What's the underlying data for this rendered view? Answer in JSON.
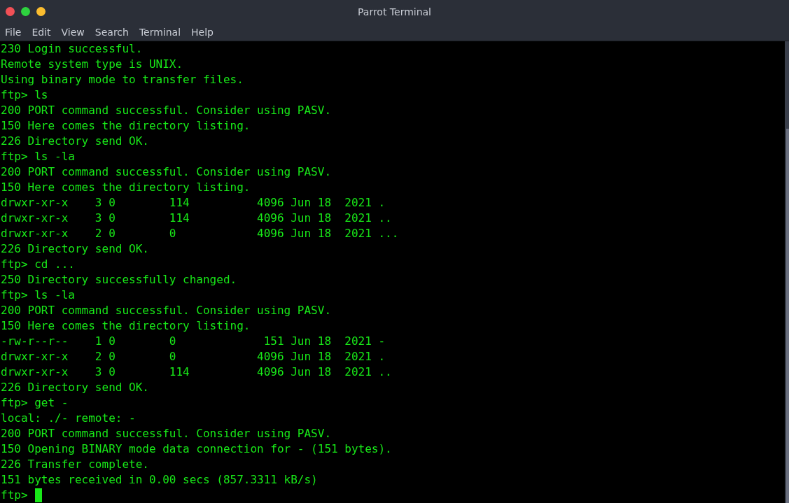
{
  "window": {
    "title": "Parrot Terminal"
  },
  "menu": [
    "File",
    "Edit",
    "View",
    "Search",
    "Terminal",
    "Help"
  ],
  "terminal": {
    "lines": [
      "230 Login successful.",
      "Remote system type is UNIX.",
      "Using binary mode to transfer files.",
      "ftp> ls",
      "200 PORT command successful. Consider using PASV.",
      "150 Here comes the directory listing.",
      "226 Directory send OK.",
      "ftp> ls -la",
      "200 PORT command successful. Consider using PASV.",
      "150 Here comes the directory listing.",
      "drwxr-xr-x    3 0        114          4096 Jun 18  2021 .",
      "drwxr-xr-x    3 0        114          4096 Jun 18  2021 ..",
      "drwxr-xr-x    2 0        0            4096 Jun 18  2021 ...",
      "226 Directory send OK.",
      "ftp> cd ...",
      "250 Directory successfully changed.",
      "ftp> ls -la",
      "200 PORT command successful. Consider using PASV.",
      "150 Here comes the directory listing.",
      "-rw-r--r--    1 0        0             151 Jun 18  2021 -",
      "drwxr-xr-x    2 0        0            4096 Jun 18  2021 .",
      "drwxr-xr-x    3 0        114          4096 Jun 18  2021 ..",
      "226 Directory send OK.",
      "ftp> get -",
      "local: ./- remote: -",
      "200 PORT command successful. Consider using PASV.",
      "150 Opening BINARY mode data connection for - (151 bytes).",
      "226 Transfer complete.",
      "151 bytes received in 0.00 secs (857.3311 kB/s)"
    ],
    "prompt": "ftp>"
  }
}
